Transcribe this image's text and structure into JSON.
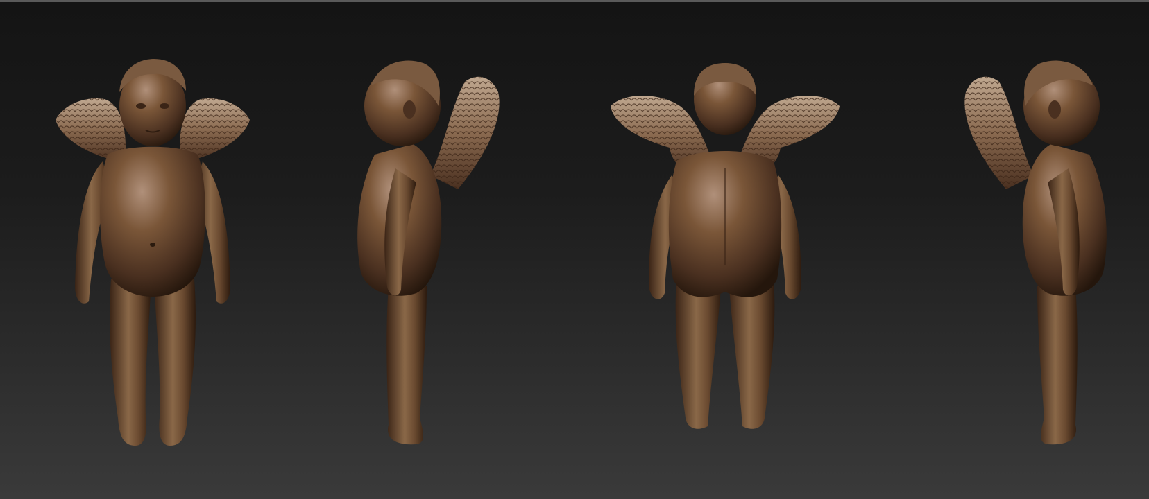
{
  "scene": {
    "background_top": "#141414",
    "background_bottom": "#3a3a3a",
    "material_color": "#6b4a30",
    "material_highlight": "#a88a6c",
    "material_shadow": "#2e1c10",
    "views": [
      {
        "id": "front",
        "orientation": "front"
      },
      {
        "id": "left",
        "orientation": "side-left"
      },
      {
        "id": "back",
        "orientation": "back"
      },
      {
        "id": "right",
        "orientation": "side-right"
      }
    ]
  }
}
